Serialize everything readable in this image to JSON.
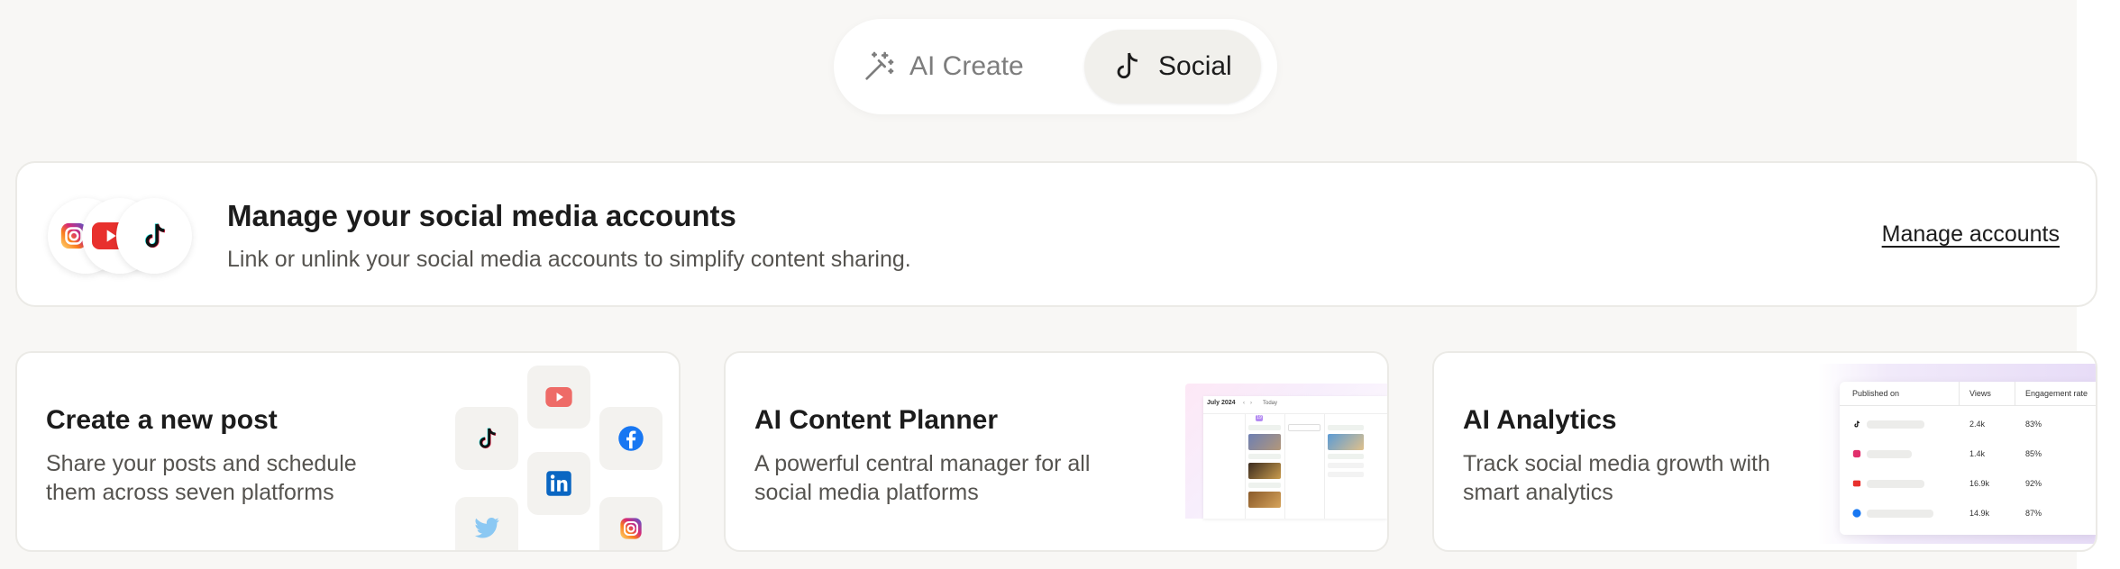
{
  "tabs": {
    "ai_create": {
      "label": "AI Create",
      "icon": "magic-wand-icon",
      "active": false
    },
    "social": {
      "label": "Social",
      "icon": "tiktok-icon",
      "active": true
    }
  },
  "banner": {
    "title": "Manage your social media accounts",
    "subtitle": "Link or unlink your social media accounts to simplify content sharing.",
    "link_label": "Manage accounts",
    "icons": [
      "instagram-icon",
      "youtube-icon",
      "tiktok-icon"
    ]
  },
  "cards": [
    {
      "title": "Create a new post",
      "description": "Share your posts and schedule them across seven platforms",
      "icons": [
        "tiktok-icon",
        "youtube-icon",
        "linkedin-icon",
        "facebook-icon",
        "twitter-icon",
        "instagram-icon"
      ]
    },
    {
      "title": "AI Content Planner",
      "description": "A powerful central manager for all social media platforms",
      "preview": {
        "month": "July 2024",
        "today_label": "Today",
        "today_date": "19"
      }
    },
    {
      "title": "AI Analytics",
      "description": "Track social media growth with smart analytics",
      "preview": {
        "headers": [
          "Published on",
          "Views",
          "Engagement rate"
        ],
        "rows": [
          {
            "platform": "tiktok-icon",
            "views": "2.4k",
            "rate": "83%"
          },
          {
            "platform": "instagram-icon",
            "views": "1.4k",
            "rate": "85%"
          },
          {
            "platform": "youtube-icon",
            "views": "16.9k",
            "rate": "92%"
          },
          {
            "platform": "facebook-icon",
            "views": "14.9k",
            "rate": "87%"
          }
        ]
      }
    }
  ],
  "colors": {
    "background": "#f8f7f5",
    "card": "#ffffff",
    "border": "#ebeae6",
    "text": "#1c1c1c",
    "muted": "#55534f",
    "youtube": "#e8302d",
    "facebook": "#1877f2",
    "linkedin": "#0a66c2",
    "twitter": "#1da1f2"
  }
}
